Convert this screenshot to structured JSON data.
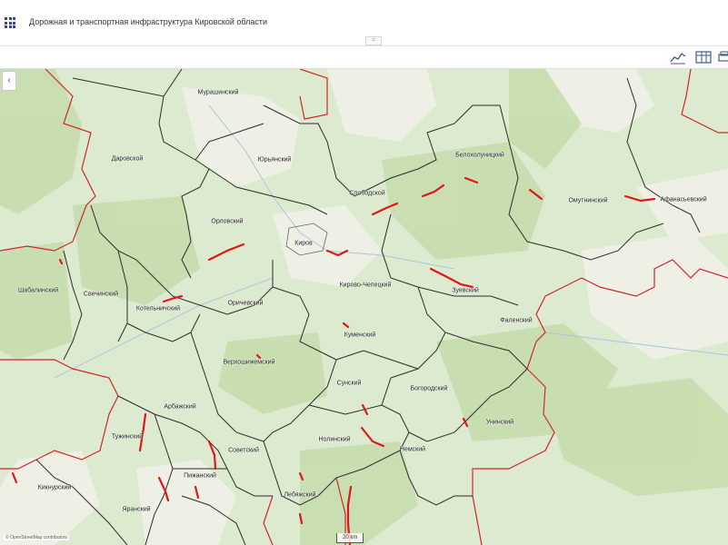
{
  "header": {
    "title": "Дорожная и транспортная инфраструктура Кировской области",
    "apps_icon": "grid-icon"
  },
  "toolbar": {
    "buttons": [
      {
        "icon": "chart-icon"
      },
      {
        "icon": "table-icon"
      },
      {
        "icon": "print-icon"
      }
    ]
  },
  "map": {
    "attribution": "© OpenStreetMap contributors",
    "scale_label": "20 km",
    "colors": {
      "forest": "#c8dfb0",
      "open_land": "#eef0e6",
      "district_border": "#2c2c2c",
      "oblast_border": "#d2262c",
      "road_segment": "#e0161b"
    },
    "regions": [
      {
        "name": "Мурашинский"
      },
      {
        "name": "Даровской"
      },
      {
        "name": "Юрьянский"
      },
      {
        "name": "Белохолуницкий"
      },
      {
        "name": "Слободской"
      },
      {
        "name": "Омутнинский"
      },
      {
        "name": "Афанасьевский"
      },
      {
        "name": "Орловский"
      },
      {
        "name": "Киров"
      },
      {
        "name": "Шабалинский"
      },
      {
        "name": "Свечинский"
      },
      {
        "name": "Котельничский"
      },
      {
        "name": "Оричевский"
      },
      {
        "name": "Кирово-Чепецкий"
      },
      {
        "name": "Зуевский"
      },
      {
        "name": "Фаленский"
      },
      {
        "name": "Куменский"
      },
      {
        "name": "Верхошижемский"
      },
      {
        "name": "Сунский"
      },
      {
        "name": "Богородский"
      },
      {
        "name": "Арбажский"
      },
      {
        "name": "Унинский"
      },
      {
        "name": "Тужинский"
      },
      {
        "name": "Нолинский"
      },
      {
        "name": "Советский"
      },
      {
        "name": "Немский"
      },
      {
        "name": "Пижанский"
      },
      {
        "name": "Кикнурский"
      },
      {
        "name": "Лебяжский"
      },
      {
        "name": "Яранский"
      }
    ]
  }
}
